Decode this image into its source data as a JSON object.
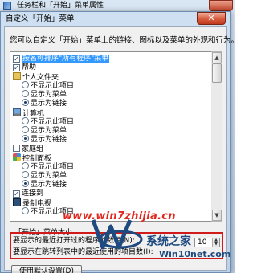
{
  "background_window": {
    "title": "任务栏和「开始」菜单属性"
  },
  "dialog": {
    "title": "自定义「开始」菜单",
    "close_label": "✕",
    "description": "您可以自定义「开始」菜单上的链接、图标以及菜单的外观和行为。"
  },
  "tree": {
    "items": [
      {
        "label": "按名称排序\"所有程序\"菜单",
        "type": "checkbox",
        "checked": true,
        "highlighted": true
      },
      {
        "label": "帮助",
        "type": "checkbox",
        "checked": true
      },
      {
        "label": "个人文件夹",
        "type": "folder"
      },
      {
        "label": "不显示此项目",
        "type": "radio",
        "checked": false
      },
      {
        "label": "显示为菜单",
        "type": "radio",
        "checked": false
      },
      {
        "label": "显示为链接",
        "type": "radio",
        "checked": true
      },
      {
        "label": "计算机",
        "type": "icon",
        "icon": "computer-icon"
      },
      {
        "label": "不显示此项目",
        "type": "radio",
        "checked": false
      },
      {
        "label": "显示为菜单",
        "type": "radio",
        "checked": false
      },
      {
        "label": "显示为链接",
        "type": "radio",
        "checked": true
      },
      {
        "label": "家庭组",
        "type": "checkbox",
        "checked": false
      },
      {
        "label": "控制面板",
        "type": "icon",
        "icon": "control-panel-icon"
      },
      {
        "label": "不显示此项目",
        "type": "radio",
        "checked": false
      },
      {
        "label": "显示为菜单",
        "type": "radio",
        "checked": false
      },
      {
        "label": "显示为链接",
        "type": "radio",
        "checked": true
      },
      {
        "label": "连接到",
        "type": "checkbox",
        "checked": true
      },
      {
        "label": "录制电视",
        "type": "icon",
        "icon": "tv-icon"
      },
      {
        "label": "不显示此项目",
        "type": "radio",
        "checked": false
      }
    ]
  },
  "size_group": {
    "title": "「开始」菜单大小",
    "recent_programs_label": "要显示的最近打开过的程序的数目(N):",
    "recent_programs_value": "10",
    "jump_list_label": "要显示在跳转列表中的最近使用的项目数(I):"
  },
  "buttons": {
    "default_settings": "使用默认设置(D)"
  },
  "watermarks": {
    "url": "www.win7zhijia.cn",
    "brand": "系统之家",
    "domain": "Win10net.com"
  },
  "colors": {
    "highlight": "#3399ff",
    "annotation_box": "#d11a1a",
    "watermark_red": "#e0281e"
  }
}
